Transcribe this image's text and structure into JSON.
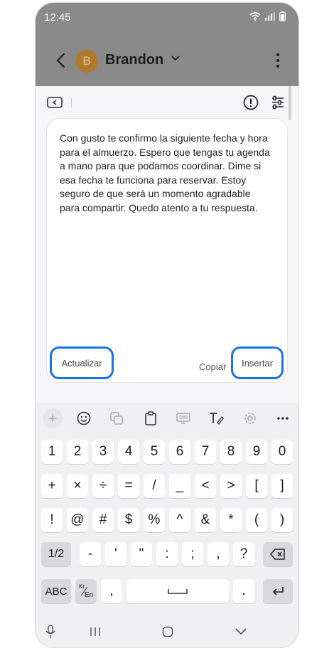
{
  "status": {
    "time": "12:45"
  },
  "header": {
    "contact_name": "Brandon",
    "avatar_letter": "B"
  },
  "panel": {
    "message": "Con gusto te confirmo la siguiente fecha y hora para el almuerzo. Espero que tengas tu agenda a mano para que podamos coordinar. Dime si esa fecha te funciona para reservar. Estoy seguro de que será un momento agradable para compartir. Quedo atento a tu respuesta.",
    "refresh_label": "Actualizar",
    "copy_label": "Copiar",
    "insert_label": "Insertar"
  },
  "keyboard": {
    "row1": [
      "1",
      "2",
      "3",
      "4",
      "5",
      "6",
      "7",
      "8",
      "9",
      "0"
    ],
    "row2": [
      "+",
      "×",
      "÷",
      "=",
      "/",
      "_",
      "<",
      ">",
      "[",
      "]"
    ],
    "row3": [
      "!",
      "@",
      "#",
      "$",
      "%",
      "^",
      "&",
      "*",
      "(",
      ")"
    ],
    "row4": [
      "1/2",
      "-",
      "'",
      "\"",
      ":",
      ";",
      ",",
      "?"
    ],
    "abc_label": "ABC",
    "lang_top": "Kr",
    "lang_bottom": "En",
    "comma": ",",
    "period": "."
  },
  "colors": {
    "accent": "#1a73e8",
    "header_bg": "#8a8a8a",
    "avatar": "#b07a2e"
  }
}
